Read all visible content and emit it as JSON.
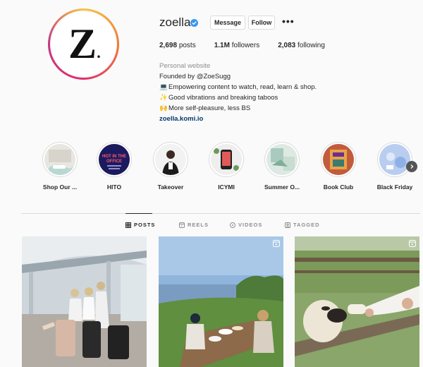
{
  "profile": {
    "username": "zoella",
    "verified": true,
    "avatar_logo": "Z.",
    "buttons": {
      "message": "Message",
      "follow": "Follow",
      "more": "•••"
    },
    "stats": {
      "posts_count": "2,698",
      "posts_label": "posts",
      "followers_count": "1.1M",
      "followers_label": "followers",
      "following_count": "2,083",
      "following_label": "following"
    },
    "bio": {
      "category": "Personal website",
      "line1": "Founded by @ZoeSugg",
      "line2": "Empowering content to watch, read, learn & shop.",
      "line3": "Good vibrations and breaking taboos",
      "line4": "More self-pleasure, less BS",
      "link": "zoella.komi.io",
      "emoji2": "💻",
      "emoji3": "✨",
      "emoji4": "🙌"
    }
  },
  "highlights": [
    {
      "label": "Shop Our ..."
    },
    {
      "label": "HITO",
      "cover_text": "HOT IN THE OFFICE"
    },
    {
      "label": "Takeover"
    },
    {
      "label": "ICYMI"
    },
    {
      "label": "Summer O..."
    },
    {
      "label": "Book Club"
    },
    {
      "label": "Black Friday"
    }
  ],
  "tabs": [
    {
      "label": "POSTS",
      "icon": "grid-icon",
      "active": true
    },
    {
      "label": "REELS",
      "icon": "reels-icon",
      "active": false
    },
    {
      "label": "VIDEOS",
      "icon": "play-icon",
      "active": false
    },
    {
      "label": "TAGGED",
      "icon": "tag-icon",
      "active": false
    }
  ],
  "posts": [
    {
      "type": "photo",
      "subject": "airport-luggage"
    },
    {
      "type": "reel",
      "subject": "clifftop-picnic"
    },
    {
      "type": "reel",
      "subject": "sheep-fence"
    }
  ],
  "colors": {
    "link": "#00376b",
    "verified": "#3897f0",
    "muted": "#8e8e8e",
    "text": "#262626"
  }
}
